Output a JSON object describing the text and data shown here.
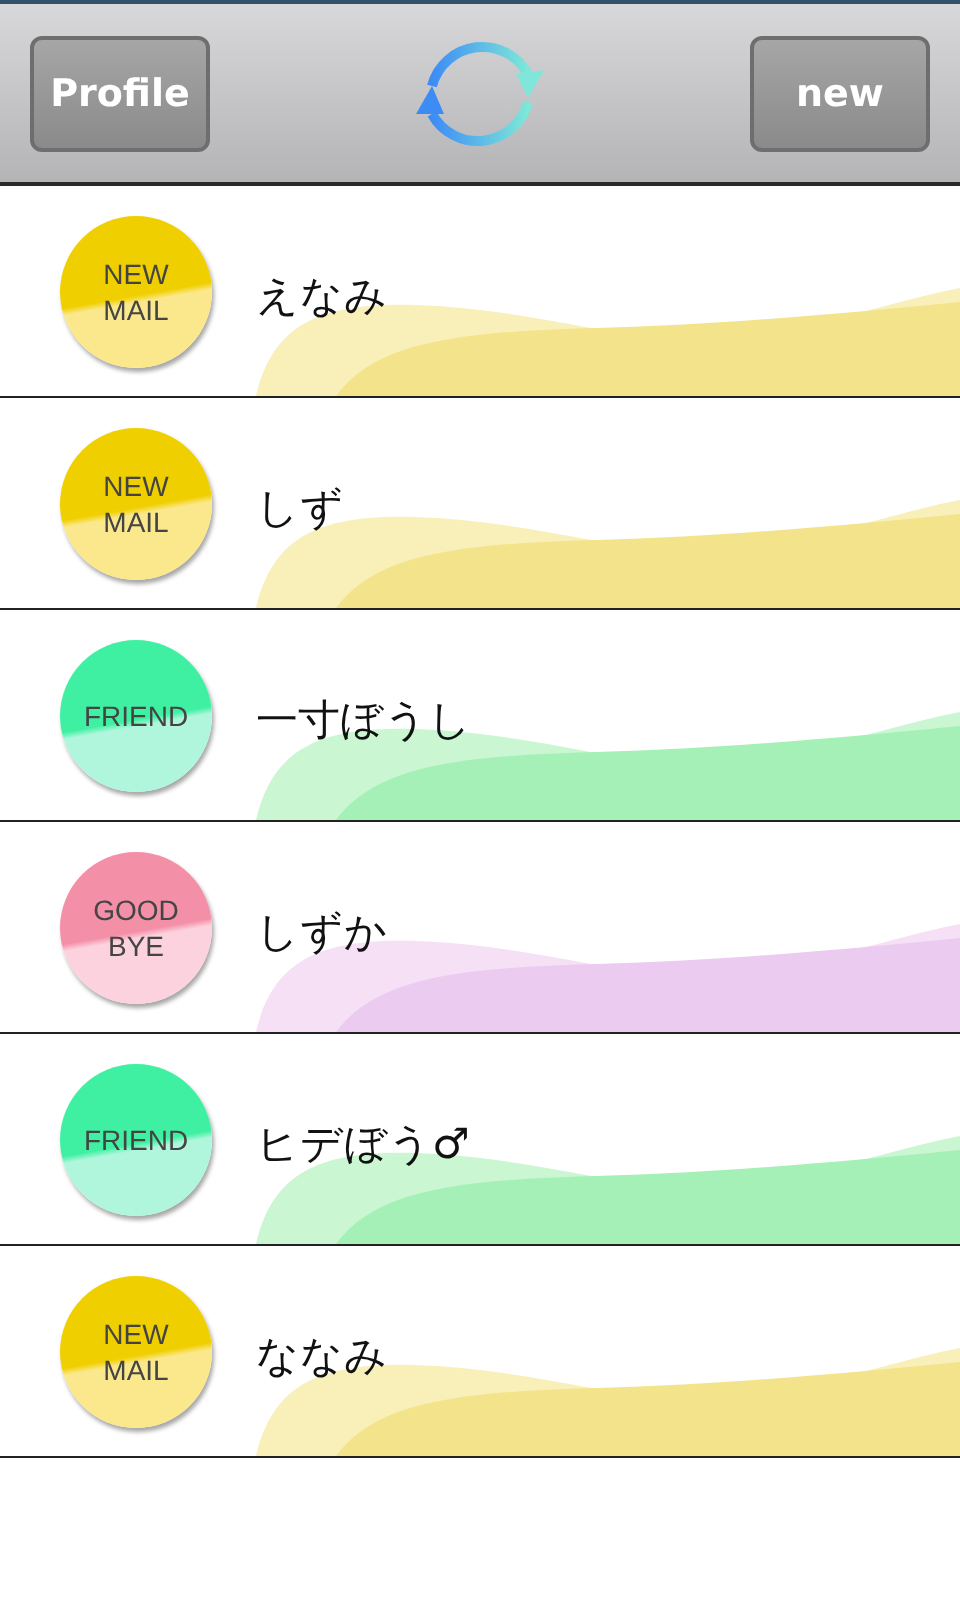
{
  "toolbar": {
    "left_button": "Profile",
    "right_button": "new"
  },
  "contacts": [
    {
      "kind": "new_mail",
      "badge": [
        "NEW",
        "MAIL"
      ],
      "name": "えなみ"
    },
    {
      "kind": "new_mail",
      "badge": [
        "NEW",
        "MAIL"
      ],
      "name": "しず"
    },
    {
      "kind": "friend",
      "badge": [
        "FRIEND"
      ],
      "name": "一寸ぼうし"
    },
    {
      "kind": "goodbye",
      "badge": [
        "GOOD",
        "BYE"
      ],
      "name": "しずか"
    },
    {
      "kind": "friend",
      "badge": [
        "FRIEND"
      ],
      "name": "ヒデぼう♂"
    },
    {
      "kind": "new_mail",
      "badge": [
        "NEW",
        "MAIL"
      ],
      "name": "ななみ"
    }
  ]
}
